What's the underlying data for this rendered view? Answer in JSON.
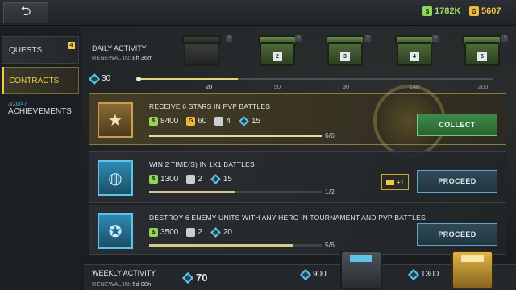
{
  "topbar": {
    "back_icon": "back-arrow-icon",
    "cash": "1782K",
    "cash_symbol": "$",
    "gold": "5607",
    "gold_symbol": "G"
  },
  "sidebar": {
    "items": [
      {
        "label": "QUESTS",
        "badge": "4"
      },
      {
        "label": "CONTRACTS"
      },
      {
        "label": "ACHIEVEMENTS",
        "count": "3/20/47"
      }
    ]
  },
  "daily": {
    "title": "DAILY ACTIVITY",
    "renewal_label": "RENEWAL IN:",
    "renewal_value": "8h 36m",
    "points": "30",
    "milestones": [
      "20",
      "50",
      "90",
      "140",
      "200"
    ],
    "progress_fraction": 0.28,
    "chest_numbers": [
      "2",
      "3",
      "4",
      "5"
    ],
    "qmark": "?"
  },
  "contracts": [
    {
      "title": "RECEIVE 6 STARS IN PVP BATTLES",
      "icon": "star-medal-icon",
      "cash": "8400",
      "gold": "60",
      "cards": "4",
      "points": "15",
      "progress": "6/6",
      "fraction": 1.0,
      "button": "COLLECT"
    },
    {
      "title": "WIN 2 TIME(S) IN 1X1 BATTLES",
      "icon": "globe-icon",
      "cash": "1300",
      "cards": "2",
      "points": "15",
      "progress": "1/2",
      "fraction": 0.5,
      "boost": "+1",
      "button": "PROCEED"
    },
    {
      "title": "DESTROY 6 ENEMY UNITS WITH ANY HERO IN TOURNAMENT AND PVP BATTLES",
      "icon": "winged-shield-icon",
      "cash": "3500",
      "cards": "2",
      "points": "20",
      "progress": "5/6",
      "fraction": 0.83,
      "button": "PROCEED"
    }
  ],
  "weekly": {
    "title": "WEEKLY ACTIVITY",
    "renewal_label": "RENEWAL IN:",
    "renewal_value": "5d 08h",
    "points": "70",
    "milestones": [
      "900",
      "1300"
    ]
  },
  "colors": {
    "accent": "#f2c84b",
    "collect": "#3e8a4a",
    "proceed": "#2f4a57",
    "points": "#5fc3e8"
  }
}
